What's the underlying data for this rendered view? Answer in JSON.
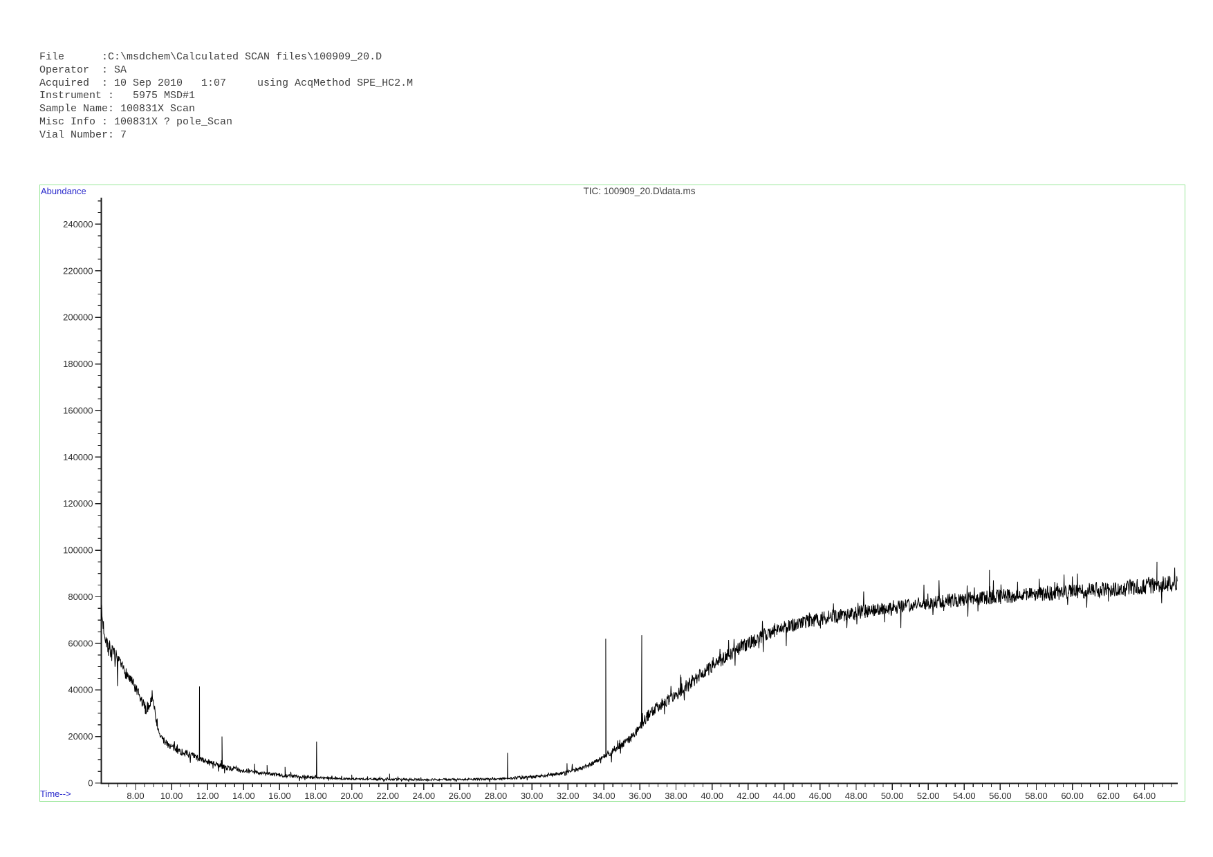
{
  "header": {
    "lines": [
      "File      :C:\\msdchem\\Calculated SCAN files\\100909_20.D",
      "Operator  : SA",
      "Acquired  : 10 Sep 2010   1:07     using AcqMethod SPE_HC2.M",
      "Instrument :   5975 MSD#1",
      "Sample Name: 100831X Scan",
      "Misc Info : 100831X ? pole_Scan",
      "Vial Number: 7"
    ]
  },
  "chart_data": {
    "type": "line",
    "title": "TIC: 100909_20.D\\data.ms",
    "xlabel": "Time-->",
    "ylabel": "Abundance",
    "xlim": [
      6.1,
      65.85
    ],
    "ylim": [
      0,
      251400
    ],
    "grid": false,
    "legend": "none",
    "x_minor_tick_step": 0.5,
    "y_minor_tick_step": 5000,
    "x_ticks": [
      [
        8,
        "8.00"
      ],
      [
        10,
        "10.00"
      ],
      [
        12,
        "12.00"
      ],
      [
        14,
        "14.00"
      ],
      [
        16,
        "16.00"
      ],
      [
        18,
        "18.00"
      ],
      [
        20,
        "20.00"
      ],
      [
        22,
        "22.00"
      ],
      [
        24,
        "24.00"
      ],
      [
        26,
        "26.00"
      ],
      [
        28,
        "28.00"
      ],
      [
        30,
        "30.00"
      ],
      [
        32,
        "32.00"
      ],
      [
        34,
        "34.00"
      ],
      [
        36,
        "36.00"
      ],
      [
        38,
        "38.00"
      ],
      [
        40,
        "40.00"
      ],
      [
        42,
        "42.00"
      ],
      [
        44,
        "44.00"
      ],
      [
        46,
        "46.00"
      ],
      [
        48,
        "48.00"
      ],
      [
        50,
        "50.00"
      ],
      [
        52,
        "52.00"
      ],
      [
        54,
        "54.00"
      ],
      [
        56,
        "56.00"
      ],
      [
        58,
        "58.00"
      ],
      [
        60,
        "60.00"
      ],
      [
        62,
        "62.00"
      ],
      [
        64,
        "64.00"
      ]
    ],
    "y_ticks": [
      [
        0,
        "0"
      ],
      [
        20000,
        "20000"
      ],
      [
        40000,
        "40000"
      ],
      [
        60000,
        "60000"
      ],
      [
        80000,
        "80000"
      ],
      [
        100000,
        "100000"
      ],
      [
        120000,
        "120000"
      ],
      [
        140000,
        "140000"
      ],
      [
        160000,
        "160000"
      ],
      [
        180000,
        "180000"
      ],
      [
        200000,
        "200000"
      ],
      [
        220000,
        "220000"
      ],
      [
        240000,
        "240000"
      ]
    ],
    "series": [
      {
        "name": "TIC",
        "baseline_anchors": [
          [
            6.1,
            74000
          ],
          [
            6.18,
            69000
          ],
          [
            6.3,
            64000
          ],
          [
            6.5,
            58500
          ],
          [
            6.8,
            54500
          ],
          [
            7.0,
            52500
          ],
          [
            7.5,
            47000
          ],
          [
            8.0,
            40500
          ],
          [
            8.3,
            35500
          ],
          [
            8.6,
            31500
          ],
          [
            8.8,
            34500
          ],
          [
            8.95,
            38000
          ],
          [
            9.1,
            29000
          ],
          [
            9.3,
            21000
          ],
          [
            9.6,
            18000
          ],
          [
            10.0,
            15500
          ],
          [
            10.5,
            13500
          ],
          [
            11.0,
            12200
          ],
          [
            11.5,
            10500
          ],
          [
            12.0,
            9200
          ],
          [
            12.5,
            7800
          ],
          [
            13.0,
            6700
          ],
          [
            14.0,
            5300
          ],
          [
            15.0,
            4300
          ],
          [
            16.0,
            3400
          ],
          [
            17.0,
            2800
          ],
          [
            18.0,
            2400
          ],
          [
            19.0,
            2000
          ],
          [
            20.0,
            1800
          ],
          [
            22.0,
            1600
          ],
          [
            24.0,
            1500
          ],
          [
            26.0,
            1500
          ],
          [
            28.0,
            1800
          ],
          [
            29.0,
            2100
          ],
          [
            30.0,
            2700
          ],
          [
            31.0,
            3400
          ],
          [
            32.0,
            4700
          ],
          [
            33.0,
            7000
          ],
          [
            33.5,
            9000
          ],
          [
            34.0,
            11500
          ],
          [
            34.5,
            14000
          ],
          [
            35.0,
            16500
          ],
          [
            35.5,
            19500
          ],
          [
            36.0,
            24000
          ],
          [
            36.5,
            29500
          ],
          [
            37.0,
            33000
          ],
          [
            38.0,
            38000
          ],
          [
            39.0,
            44000
          ],
          [
            40.0,
            50000
          ],
          [
            41.0,
            55500
          ],
          [
            42.0,
            60000
          ],
          [
            43.0,
            64000
          ],
          [
            44.0,
            67000
          ],
          [
            45.0,
            69000
          ],
          [
            46.0,
            70500
          ],
          [
            47.0,
            72000
          ],
          [
            48.0,
            73000
          ],
          [
            49.0,
            74500
          ],
          [
            50.0,
            75500
          ],
          [
            52.0,
            77500
          ],
          [
            54.0,
            79000
          ],
          [
            56.0,
            80200
          ],
          [
            58.0,
            81000
          ],
          [
            60.0,
            82300
          ],
          [
            62.0,
            83200
          ],
          [
            64.0,
            84500
          ],
          [
            65.85,
            86000
          ]
        ],
        "peaks": [
          [
            11.55,
            41500
          ],
          [
            12.8,
            20000
          ],
          [
            14.6,
            8300
          ],
          [
            15.3,
            7700
          ],
          [
            16.3,
            6900
          ],
          [
            18.05,
            17800
          ],
          [
            20.0,
            3600
          ],
          [
            22.1,
            4000
          ],
          [
            28.65,
            13000
          ],
          [
            31.95,
            8500
          ],
          [
            34.1,
            62000
          ],
          [
            36.1,
            63500
          ],
          [
            38.25,
            46500
          ],
          [
            55.4,
            91500
          ],
          [
            64.7,
            95000
          ]
        ],
        "noise_amplitude_segments": [
          [
            6.1,
            7.0,
            4000
          ],
          [
            7.0,
            9.0,
            2600
          ],
          [
            9.0,
            11.5,
            1600
          ],
          [
            11.5,
            14.0,
            1100
          ],
          [
            14.0,
            18.0,
            800
          ],
          [
            18.0,
            29.0,
            450
          ],
          [
            29.0,
            32.0,
            700
          ],
          [
            32.0,
            34.0,
            1000
          ],
          [
            34.0,
            36.0,
            1600
          ],
          [
            36.0,
            38.0,
            2400
          ],
          [
            38.0,
            44.0,
            2900
          ],
          [
            44.0,
            52.0,
            3000
          ],
          [
            52.0,
            60.0,
            3100
          ],
          [
            60.0,
            65.85,
            3400
          ]
        ]
      }
    ],
    "colors": {
      "trace": "#000000",
      "axis": "#1c1c1c",
      "tick_label": "#2d2d2d",
      "title": "#3f3f3f",
      "axis_name_labels": "#2929cc",
      "frame": "#98e698",
      "header_text": "#3f3f3f",
      "background": "#ffffff"
    }
  }
}
